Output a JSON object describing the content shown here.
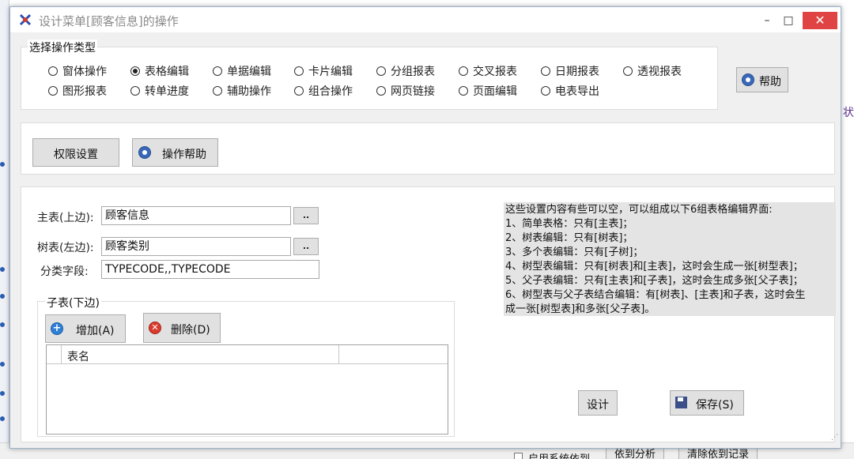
{
  "window": {
    "title": "设计菜单[顾客信息]的操作",
    "min": "–",
    "max": "□",
    "close": "✕"
  },
  "operation_type": {
    "title": "选择操作类型",
    "options": [
      "窗体操作",
      "表格编辑",
      "单据编辑",
      "卡片编辑",
      "分组报表",
      "交叉报表",
      "日期报表",
      "透视报表",
      "图形报表",
      "转单进度",
      "辅助操作",
      "组合操作",
      "网页链接",
      "页面编辑",
      "电表导出"
    ],
    "selected": "表格编辑"
  },
  "help_button": "帮助",
  "perm_button": "权限设置",
  "op_help_button": "操作帮助",
  "form": {
    "main_table_label": "主表(上边):",
    "main_table_value": "顾客信息",
    "tree_table_label": "树表(左边):",
    "tree_table_value": "顾客类别",
    "category_label": "分类字段:",
    "category_value": "TYPECODE,,TYPECODE",
    "ellipsis": ".."
  },
  "child": {
    "title": "子表(下边)",
    "add": "增加(A)",
    "delete": "删除(D)",
    "col_name": "表名"
  },
  "notes": [
    "这些设置内容有些可以空，可以组成以下6组表格编辑界面:",
    "1、简单表格：只有[主表]；",
    "2、树表编辑：只有[树表]；",
    "3、多个表编辑：只有[子树]；",
    "4、树型表编辑：只有[树表]和[主表]，这时会生成一张[树型表]；",
    "5、父子表编辑：只有[主表]和[子表]，这时会生成多张[父子表]；",
    "6、树型表与父子表结合编辑：有[树表]、[主表]和子表，这时会生",
    "成一张[树型表]和多张[父子表]。"
  ],
  "design_button": "设计",
  "save_button": "保存(S)",
  "background": {
    "bottom_btn1": "依到分析",
    "bottom_btn2": "清除依到记录",
    "bottom_chk": "启用系统依到",
    "right_char": "状"
  }
}
